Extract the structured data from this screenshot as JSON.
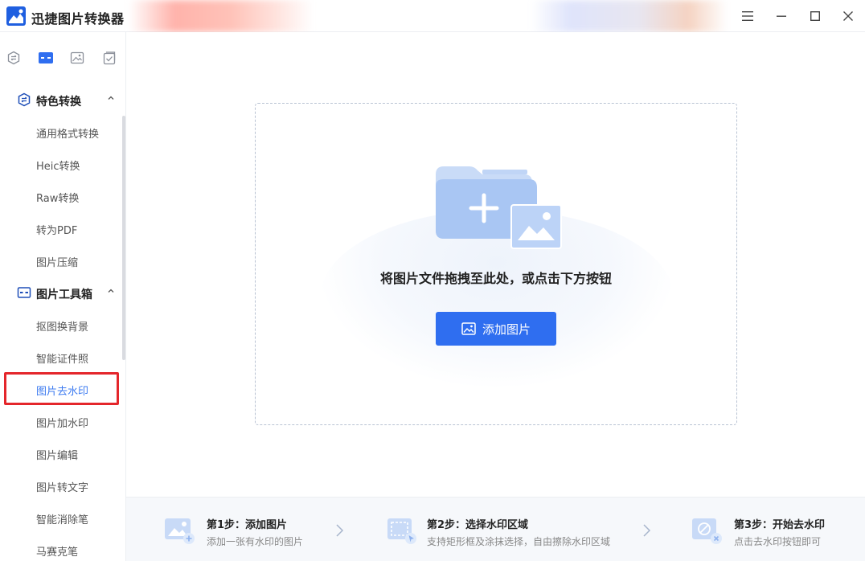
{
  "app": {
    "title": "迅捷图片转换器"
  },
  "colors": {
    "accent": "#2f6ef0",
    "active_text": "#3d7bf0",
    "highlight": "#e4262b"
  },
  "window_controls": [
    "menu-icon",
    "minimize-icon",
    "maximize-icon",
    "close-icon"
  ],
  "icon_tabs": [
    "convert-icon",
    "toolbox-icon",
    "image-icon",
    "checklist-icon"
  ],
  "sidebar": {
    "group1": {
      "label": "特色转换",
      "items": [
        "通用格式转换",
        "Heic转换",
        "Raw转换",
        "转为PDF",
        "图片压缩"
      ]
    },
    "group2": {
      "label": "图片工具箱",
      "items": [
        "抠图换背景",
        "智能证件照",
        "图片去水印",
        "图片加水印",
        "图片编辑",
        "图片转文字",
        "智能消除笔",
        "马赛克笔"
      ]
    },
    "active_item": "图片去水印"
  },
  "dropzone": {
    "text": "将图片文件拖拽至此处，或点击下方按钮",
    "button_label": "添加图片"
  },
  "steps": [
    {
      "title": "第1步：添加图片",
      "desc": "添加一张有水印的图片"
    },
    {
      "title": "第2步：选择水印区域",
      "desc": "支持矩形框及涂抹选择，自由擦除水印区域"
    },
    {
      "title": "第3步：开始去水印",
      "desc": "点击去水印按钮即可"
    }
  ]
}
